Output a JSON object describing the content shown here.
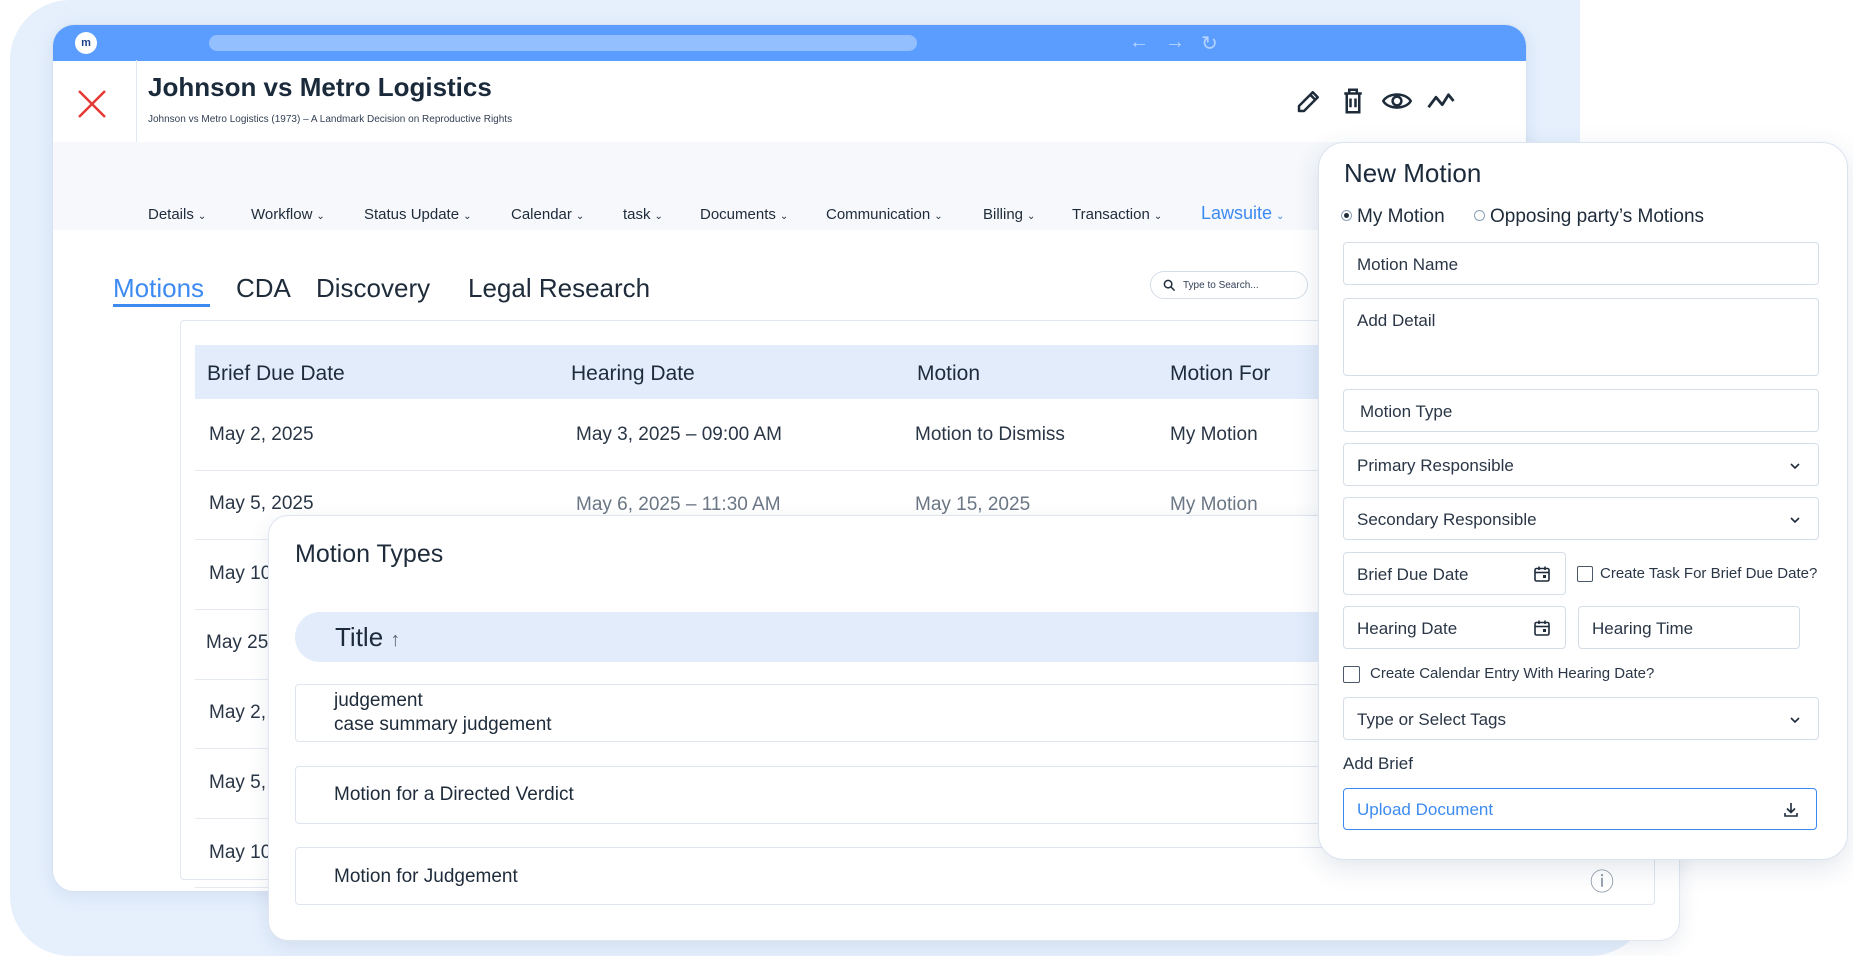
{
  "app": {
    "logo_text": "m",
    "nav_back": "←",
    "nav_forward": "→",
    "nav_reload": "↻"
  },
  "case": {
    "title": "Johnson vs Metro Logistics",
    "subtitle": "Johnson vs Metro Logistics (1973) – A Landmark Decision on Reproductive Rights",
    "actions": [
      "edit-icon",
      "delete-icon",
      "view-icon",
      "analytics-icon"
    ]
  },
  "menu": [
    {
      "label": "Details",
      "chevron": "⌄"
    },
    {
      "label": "Workflow",
      "chevron": "⌄"
    },
    {
      "label": "Status Update",
      "chevron": "⌄"
    },
    {
      "label": "Calendar",
      "chevron": "⌄"
    },
    {
      "label": "task",
      "chevron": "⌄"
    },
    {
      "label": "Documents",
      "chevron": "⌄"
    },
    {
      "label": "Communication",
      "chevron": "⌄"
    },
    {
      "label": "Billing",
      "chevron": "⌄"
    },
    {
      "label": "Transaction",
      "chevron": "⌄"
    },
    {
      "label": "Lawsuite",
      "chevron": "⌄",
      "active": true
    }
  ],
  "subtabs": [
    "Motions",
    "CDA",
    "Discovery",
    "Legal Research"
  ],
  "search": {
    "placeholder": "Type to Search..."
  },
  "table": {
    "headers": [
      "Brief Due Date",
      "Hearing Date",
      "Motion",
      "Motion For"
    ],
    "rows": [
      [
        "May 2, 2025",
        "May 3, 2025 – 09:00 AM",
        "Motion to Dismiss",
        "My Motion"
      ],
      [
        "May 5, 2025",
        "May 6, 2025 – 11:30 AM",
        "May 15, 2025",
        "My Motion"
      ],
      [
        "May 10",
        "",
        "",
        ""
      ],
      [
        "May 25",
        "",
        "",
        ""
      ],
      [
        "May 2,",
        "",
        "",
        ""
      ],
      [
        "May 5,",
        "",
        "",
        ""
      ],
      [
        "May 10",
        "",
        "",
        ""
      ]
    ]
  },
  "motion_types": {
    "title": "Motion Types",
    "column": "Title",
    "sort_icon": "↑",
    "items": [
      {
        "line1": "judgement",
        "line2": "case summary judgement"
      },
      {
        "line1": "Motion for a Directed Verdict"
      },
      {
        "line1": "Motion for Judgement"
      }
    ],
    "info_icon": "ⓘ"
  },
  "form": {
    "title": "New Motion",
    "radio_my": "My Motion",
    "radio_opposing": "Opposing party’s Motions",
    "motion_name": "Motion Name",
    "add_detail": "Add Detail",
    "motion_type": "Motion Type",
    "primary_responsible": "Primary Responsible",
    "secondary_responsible": "Secondary Responsible",
    "brief_due_date": "Brief Due Date",
    "create_task_label": "Create  Task For Brief Due Date?",
    "hearing_date": "Hearing Date",
    "hearing_time": "Hearing Time",
    "calendar_entry_label": "Create Calendar Entry With Hearing Date?",
    "tags": "Type or Select Tags",
    "add_brief": "Add Brief",
    "upload": "Upload Document"
  },
  "colors": {
    "accent": "#3d8bf2",
    "titlebar": "#5a9dff",
    "close": "#e53935",
    "header_bg": "#e2ecfb",
    "page_bg": "#e6f0fd"
  }
}
